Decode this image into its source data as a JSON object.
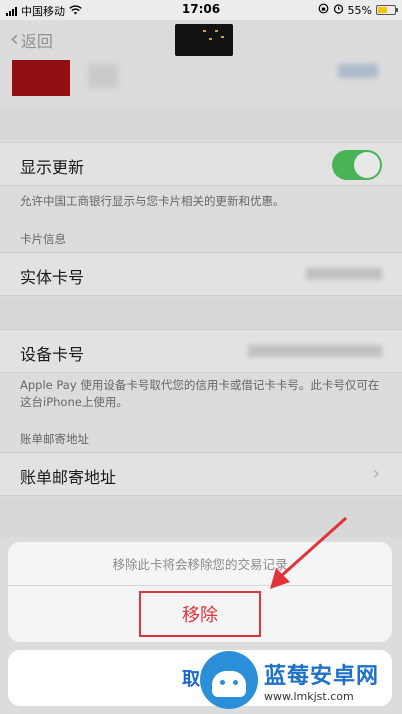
{
  "status_bar": {
    "carrier": "中国移动",
    "time": "17:06",
    "battery_percent": "55%",
    "battery_level": 0.55
  },
  "nav": {
    "back_label": "返回"
  },
  "settings": {
    "show_updates_label": "显示更新",
    "show_updates_on": true,
    "show_updates_note": "允许中国工商银行显示与您卡片相关的更新和优惠。",
    "card_info_header": "卡片信息",
    "physical_card_label": "实体卡号",
    "device_card_label": "设备卡号",
    "device_card_note": "Apple Pay 使用设备卡号取代您的信用卡或借记卡卡号。此卡号仅可在这台iPhone上使用。",
    "billing_header": "账单邮寄地址",
    "billing_label": "账单邮寄地址"
  },
  "action_sheet": {
    "message": "移除此卡将会移除您的交易记录",
    "remove_label": "移除",
    "cancel_label": "取消"
  },
  "colors": {
    "toggle_on": "#4cbf5a",
    "destructive": "#e0333a",
    "cancel": "#1a66d4"
  },
  "watermark": {
    "title": "蓝莓安卓网",
    "url": "www.lmkjst.com"
  }
}
